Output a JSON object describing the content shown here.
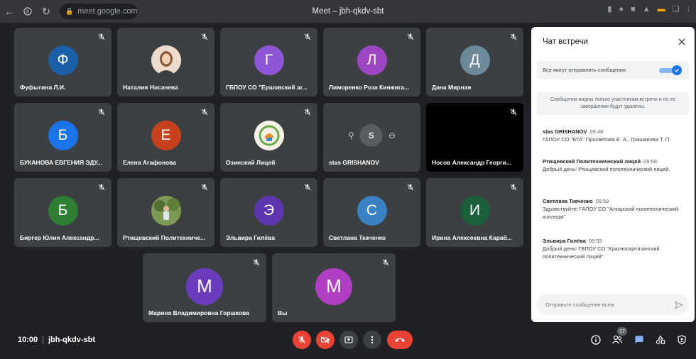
{
  "browser": {
    "url": "meet.google.com",
    "title": "Meet – jbh-qkdv-sbt"
  },
  "colors": {
    "background": "#202124",
    "tile": "#3c4043",
    "red": "#ea4335",
    "accent": "#1a73e8"
  },
  "tiles": [
    {
      "name": "Фуфыгина Л.И.",
      "initial": "Ф",
      "color": "#1a5fa8",
      "icon": "avatar"
    },
    {
      "name": "Наталия Носачева",
      "initial": "",
      "color": "#e8d4c4",
      "icon": "photo-avatar-woman"
    },
    {
      "name": "ГБПОУ СО \"Ершовский аг...",
      "initial": "Г",
      "color": "#8e55d6",
      "icon": "avatar"
    },
    {
      "name": "Лиморенко Роза Кинжига...",
      "initial": "Л",
      "color": "#9c46c4",
      "icon": "avatar"
    },
    {
      "name": "Дана Мирная",
      "initial": "Д",
      "color": "#6e8a9a",
      "icon": "avatar"
    },
    {
      "name": "БУКАНОВА ЕВГЕНИЯ ЭДУ...",
      "initial": "Б",
      "color": "#1a73e8",
      "icon": "avatar"
    },
    {
      "name": "Елена Агафонова",
      "initial": "Е",
      "color": "#c5411b",
      "icon": "avatar"
    },
    {
      "name": "Озинский Лицей",
      "initial": "",
      "color": "#f5f1e0",
      "icon": "logo-avatar"
    },
    {
      "name": "stas GRISHANOV",
      "initial": "S",
      "color": "#5f6368",
      "icon": "hover-controls"
    },
    {
      "name": "Носов Александр Георги...",
      "initial": "",
      "color": "#000000",
      "icon": "video-off"
    },
    {
      "name": "Биргер Юлия Александр...",
      "initial": "Б",
      "color": "#2e7d32",
      "icon": "avatar"
    },
    {
      "name": "Ртищевский Политехниче...",
      "initial": "",
      "color": "#6d8a4a",
      "icon": "photo-avatar-outdoor"
    },
    {
      "name": "Эльвира Гилёва",
      "initial": "Э",
      "color": "#5e35b1",
      "icon": "avatar"
    },
    {
      "name": "Светлана Ткаченко",
      "initial": "С",
      "color": "#3b82c4",
      "icon": "avatar"
    },
    {
      "name": "Ирина Алексеевна Караб...",
      "initial": "И",
      "color": "#1b5e3c",
      "icon": "avatar"
    },
    {
      "name": "Марина Владимировна Горшкова",
      "initial": "М",
      "color": "#6a3bbd",
      "icon": "avatar"
    },
    {
      "name": "Вы",
      "initial": "М",
      "color": "#b13fc4",
      "icon": "avatar"
    }
  ],
  "bottom_bar": {
    "time": "10:00",
    "separator": "|",
    "meeting_code": "jbh-qkdv-sbt",
    "participants_count": "17"
  },
  "chat": {
    "title": "Чат встречи",
    "toggle_label": "Все могут отправлять сообщения",
    "toggle_on": true,
    "notice": "Сообщения видны только участникам встречи и по ее завершении будут удалены.",
    "messages": [
      {
        "sender": "stas GRISHANOV",
        "time": "09:48",
        "text": "ГАПОУ СО \"БТА\" Просветова Е. А., Гришанова Т. П."
      },
      {
        "sender": "Ртищевский Политехнический лицей",
        "time": "09:58",
        "text": "Добрый день! Ртищевский политехнический лицей."
      },
      {
        "sender": "Светлана Ткаченко",
        "time": "09:59",
        "text": "Здравствуйте! ГАПОУ СО \"Аткарский политехнический колледж\""
      },
      {
        "sender": "Эльвира Гилёва",
        "time": "09:59",
        "text": "Добрый день! ГБПОУ СО \"Краснопартизанский политехнический лицей\""
      }
    ],
    "input_placeholder": "Отправьте сообщение всем"
  }
}
